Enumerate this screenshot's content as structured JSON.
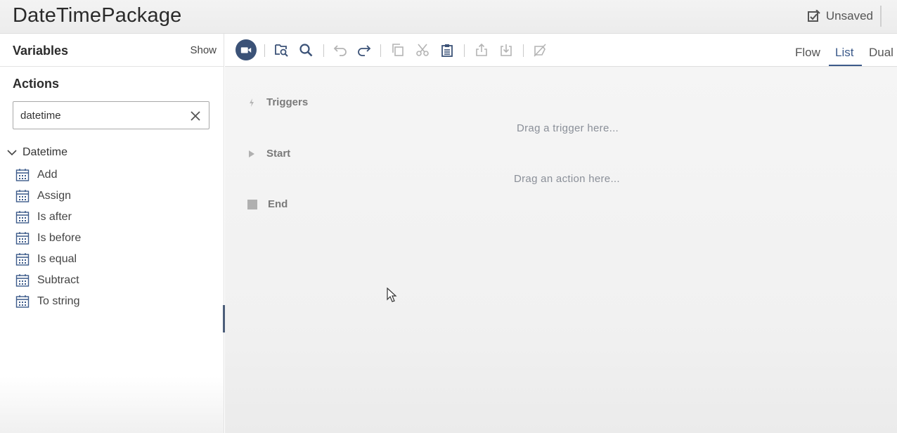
{
  "header": {
    "title": "DateTimePackage",
    "save_status": "Unsaved"
  },
  "sidebar": {
    "variables_title": "Variables",
    "variables_toggle": "Show",
    "actions_title": "Actions",
    "search": {
      "value": "datetime",
      "placeholder": ""
    },
    "group": {
      "label": "Datetime",
      "items": [
        {
          "label": "Add",
          "icon": "calendar-icon"
        },
        {
          "label": "Assign",
          "icon": "calendar-icon"
        },
        {
          "label": "Is after",
          "icon": "calendar-icon"
        },
        {
          "label": "Is before",
          "icon": "calendar-icon"
        },
        {
          "label": "Is equal",
          "icon": "calendar-icon"
        },
        {
          "label": "Subtract",
          "icon": "calendar-icon"
        },
        {
          "label": "To string",
          "icon": "calendar-icon"
        }
      ]
    }
  },
  "toolbar": {
    "view_tabs": [
      {
        "label": "Flow",
        "active": false
      },
      {
        "label": "List",
        "active": true
      },
      {
        "label": "Dual",
        "active": false
      }
    ]
  },
  "canvas": {
    "triggers_label": "Triggers",
    "trigger_hint": "Drag a trigger here...",
    "start_label": "Start",
    "action_hint": "Drag an action here...",
    "end_label": "End"
  },
  "colors": {
    "accent": "#3c5a8a",
    "record_button": "#3b5277",
    "splitter": "#4c5e7a"
  }
}
